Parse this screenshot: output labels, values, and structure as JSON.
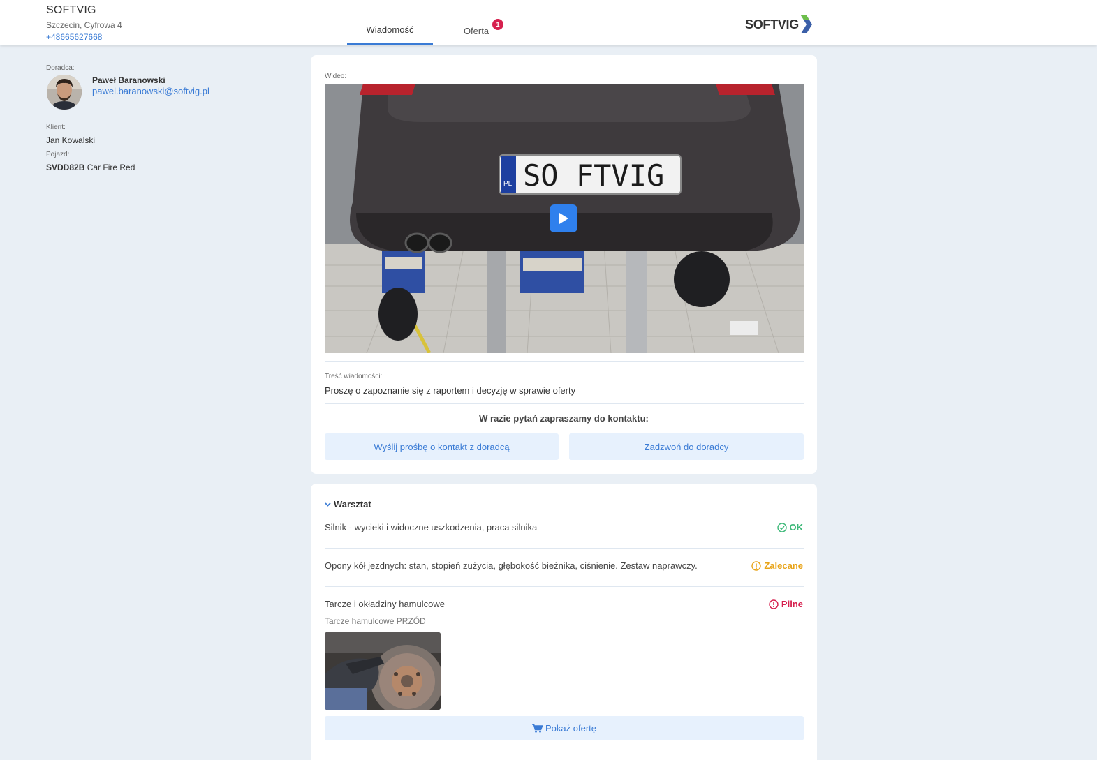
{
  "header": {
    "company_name": "SOFTVIG",
    "address": "Szczecin, Cyfrowa 4",
    "phone": "+48665627668",
    "tabs": [
      {
        "label": "Wiadomość",
        "active": true
      },
      {
        "label": "Oferta",
        "badge": "1"
      }
    ],
    "logo_text": "SOFTVIG"
  },
  "sidebar": {
    "advisor_label": "Doradca:",
    "advisor_name": "Paweł Baranowski",
    "advisor_email": "pawel.baranowski@softvig.pl",
    "client_label": "Klient:",
    "client_name": "Jan Kowalski",
    "vehicle_label": "Pojazd:",
    "vehicle_plate": "SVDD82B",
    "vehicle_desc": "Car Fire Red"
  },
  "message_card": {
    "video_label": "Wideo:",
    "plate_prefix": "PL",
    "plate_text": "SO FTVIG",
    "message_label": "Treść wiadomości:",
    "message_text": "Proszę o zapoznanie się z raportem i decyzję w sprawie oferty",
    "contact_prompt": "W razie pytań zapraszamy do kontaktu:",
    "request_button": "Wyślij prośbę o kontakt z doradcą",
    "call_button": "Zadzwoń do doradcy"
  },
  "workshop": {
    "title": "Warsztat",
    "items": [
      {
        "text": "Silnik - wycieki i widoczne uszkodzenia, praca silnika",
        "status": "OK"
      },
      {
        "text": "Opony kół jezdnych: stan, stopień zużycia, głębokość bieżnika, ciśnienie. Zestaw naprawczy.",
        "status": "Zalecane"
      },
      {
        "text": "Tarcze i okładziny hamulcowe",
        "status": "Pilne",
        "sub_label": "Tarcze hamulcowe PRZÓD"
      }
    ],
    "offer_button": "Pokaż ofertę"
  },
  "colors": {
    "accent": "#3a7bd5",
    "ok": "#3cb878",
    "recommended": "#e8a317",
    "urgent": "#d6204e",
    "background": "#e9eff5"
  }
}
